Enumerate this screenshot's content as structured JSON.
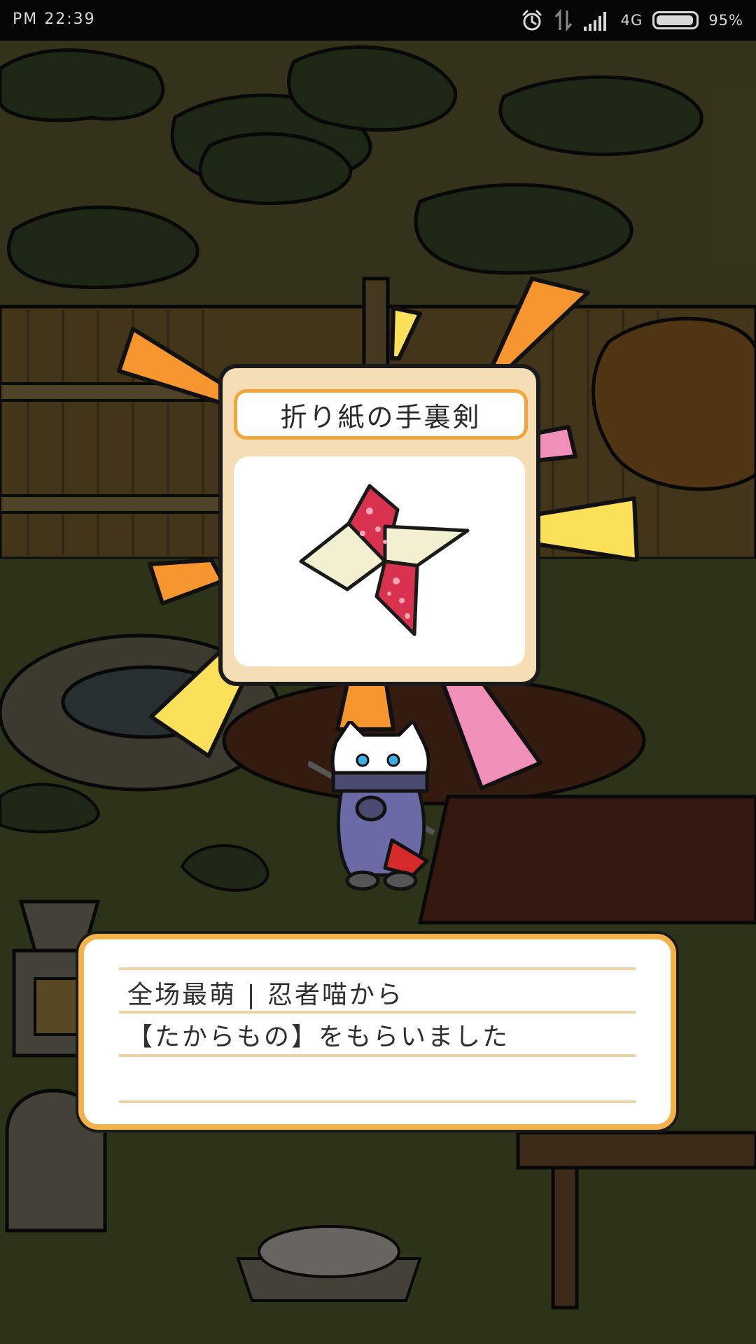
{
  "status_bar": {
    "time": "PM  22:39",
    "network": "4G",
    "battery_percent": "95%",
    "battery_level": 0.95,
    "icons": [
      "alarm-clock-icon",
      "data-transfer-icon",
      "signal-bars-icon",
      "battery-icon"
    ]
  },
  "reward": {
    "title": "折り紙の手裏剣",
    "item_icon": "origami-shuriken-icon"
  },
  "message": {
    "line1": "全场最萌 | 忍者喵から",
    "line2": "【たからもの】をもらいました"
  },
  "colors": {
    "ray_orange": "#f7962f",
    "ray_yellow": "#fbe05a",
    "ray_pink": "#f08fb8",
    "card_frame": "#f5ddb5",
    "dialog_border": "#f3b24a",
    "dialog_rule": "#ebd3a3",
    "shuriken_red": "#d8324f",
    "shuriken_cream": "#f3f0d2"
  }
}
